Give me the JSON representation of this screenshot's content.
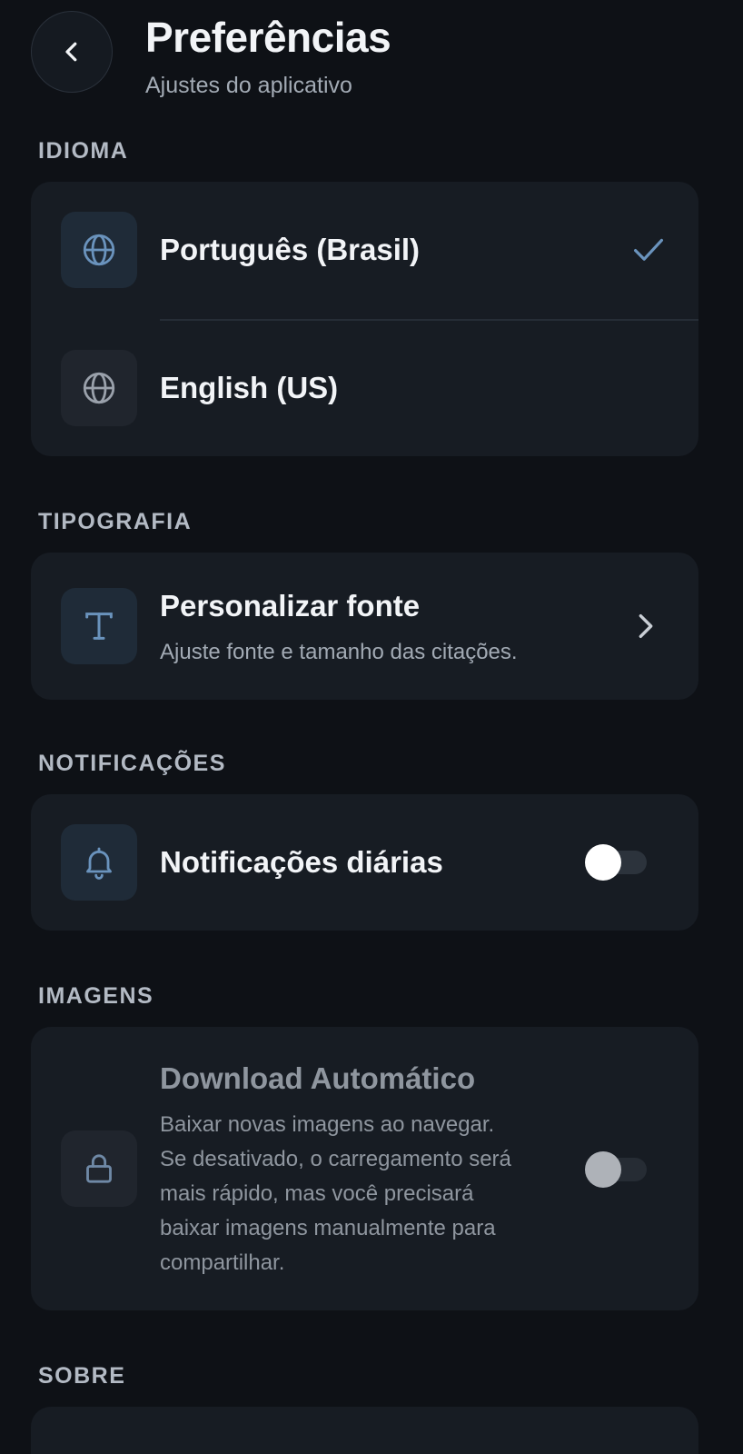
{
  "header": {
    "title": "Preferências",
    "subtitle": "Ajustes do aplicativo"
  },
  "sections": {
    "language": {
      "label": "IDIOMA",
      "options": [
        {
          "label": "Português (Brasil)",
          "selected": true
        },
        {
          "label": "English (US)",
          "selected": false
        }
      ]
    },
    "typography": {
      "label": "TIPOGRAFIA",
      "item": {
        "title": "Personalizar fonte",
        "description": "Ajuste fonte e tamanho das citações."
      }
    },
    "notifications": {
      "label": "NOTIFICAÇÕES",
      "item": {
        "title": "Notificações diárias",
        "enabled": false
      }
    },
    "images": {
      "label": "IMAGENS",
      "item": {
        "title": "Download Automático",
        "description_lines": [
          "Baixar novas imagens ao navegar.",
          "Se desativado, o carregamento será",
          "mais rápido, mas você precisará",
          "baixar imagens manualmente para",
          "compartilhar."
        ],
        "enabled": false,
        "disabled": true
      }
    },
    "about": {
      "label": "SOBRE"
    }
  },
  "colors": {
    "background": "#0e1116",
    "card": "#171c23",
    "accent": "#6a93bd",
    "muted_icon": "#9aa1ab"
  },
  "icons": {
    "back": "chevron-left-icon",
    "language": "globe-icon",
    "selected": "check-icon",
    "font": "type-icon",
    "chevron": "chevron-right-icon",
    "notification": "bell-icon",
    "images": "lock-icon"
  }
}
